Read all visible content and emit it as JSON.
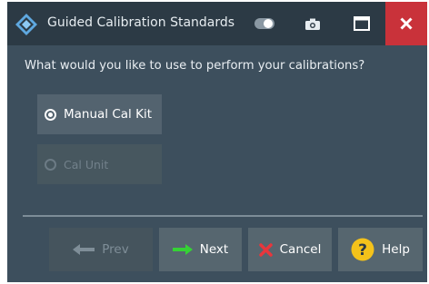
{
  "window": {
    "title": "Guided Calibration Standards"
  },
  "question": "What would you like to use to perform your calibrations?",
  "options": [
    {
      "label": "Manual Cal Kit",
      "selected": true,
      "enabled": true
    },
    {
      "label": "Cal Unit",
      "selected": false,
      "enabled": false
    }
  ],
  "footer": {
    "prev_label": "Prev",
    "next_label": "Next",
    "cancel_label": "Cancel",
    "help_label": "Help"
  },
  "icons": {
    "logo": "rs-diamond-logo-icon",
    "toggle": "toggle-icon",
    "camera": "camera-icon",
    "maximize": "maximize-icon",
    "close": "close-icon",
    "prev": "arrow-left-icon",
    "next": "arrow-right-icon",
    "cancel": "x-mark-icon",
    "help": "question-mark-icon"
  },
  "colors": {
    "window_bg": "#3d4f5d",
    "titlebar_bg": "#2c3a45",
    "close_bg": "#c9323a",
    "next_arrow": "#35d235",
    "cancel_x": "#e8363c",
    "help_circle": "#f4c21a"
  }
}
